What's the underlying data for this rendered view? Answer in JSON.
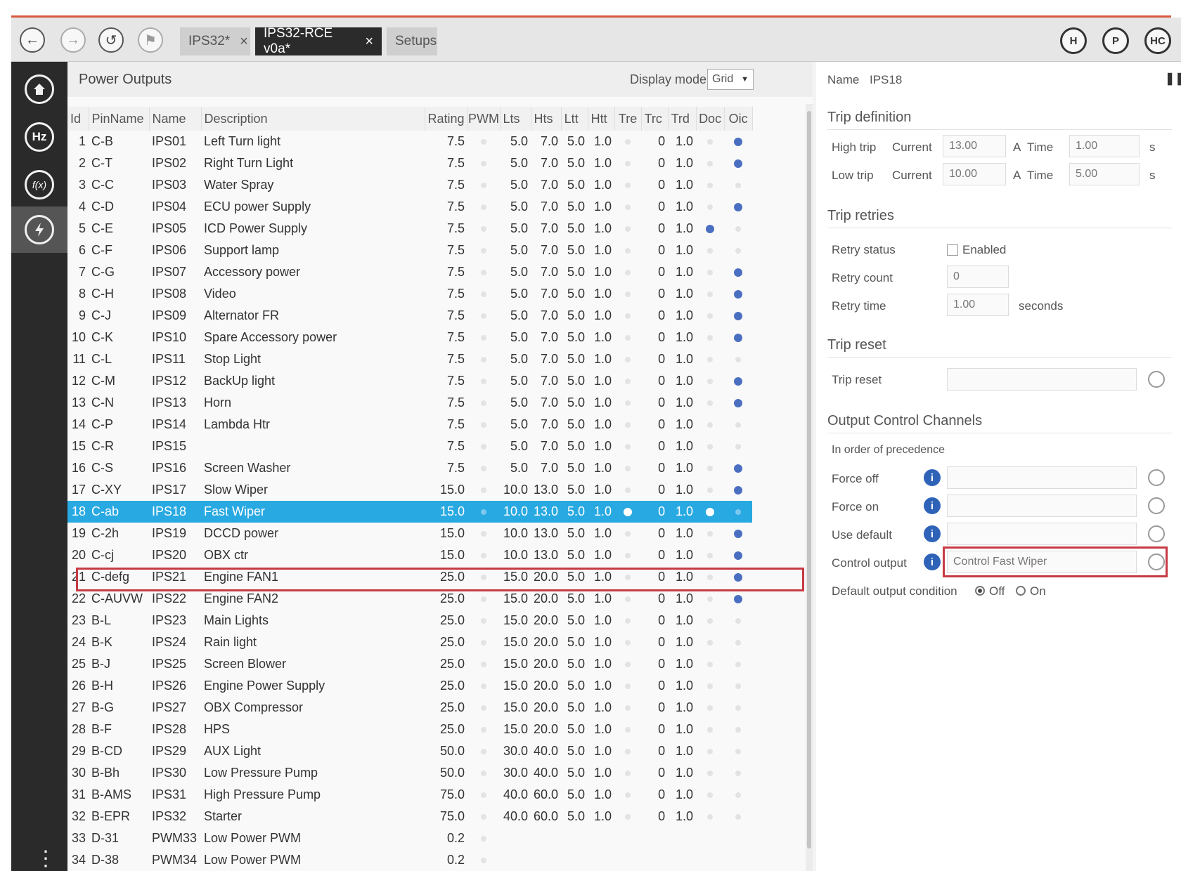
{
  "toolbar": {
    "tabs": [
      {
        "label": "IPS32*",
        "close": "×"
      },
      {
        "label": "IPS32-RCE v0a*",
        "close": "×"
      },
      {
        "label": "Setups"
      }
    ],
    "right_buttons": [
      "H",
      "P",
      "HC"
    ]
  },
  "sidebar": {
    "items": [
      "home",
      "Hz",
      "f(x)",
      "power"
    ]
  },
  "outputs": {
    "title": "Power Outputs",
    "display_mode_label": "Display mode",
    "display_mode_value": "Grid",
    "columns": [
      "Id",
      "PinName",
      "Name",
      "Description",
      "Rating",
      "PWM",
      "Lts",
      "Hts",
      "Ltt",
      "Htt",
      "Tre",
      "Trc",
      "Trd",
      "Doc",
      "Oic"
    ],
    "rows": [
      {
        "id": "1",
        "pin": "C-B",
        "name": "IPS01",
        "desc": "Left Turn light",
        "rating": "7.5",
        "pwm": false,
        "lts": "5.0",
        "hts": "7.0",
        "ltt": "5.0",
        "htt": "1.0",
        "tre": false,
        "trc": "0",
        "trd": "1.0",
        "doc": false,
        "oic": true
      },
      {
        "id": "2",
        "pin": "C-T",
        "name": "IPS02",
        "desc": "Right Turn Light",
        "rating": "7.5",
        "pwm": false,
        "lts": "5.0",
        "hts": "7.0",
        "ltt": "5.0",
        "htt": "1.0",
        "tre": false,
        "trc": "0",
        "trd": "1.0",
        "doc": false,
        "oic": true
      },
      {
        "id": "3",
        "pin": "C-C",
        "name": "IPS03",
        "desc": "Water Spray",
        "rating": "7.5",
        "pwm": false,
        "lts": "5.0",
        "hts": "7.0",
        "ltt": "5.0",
        "htt": "1.0",
        "tre": false,
        "trc": "0",
        "trd": "1.0",
        "doc": false,
        "oic": false
      },
      {
        "id": "4",
        "pin": "C-D",
        "name": "IPS04",
        "desc": "ECU power Supply",
        "rating": "7.5",
        "pwm": false,
        "lts": "5.0",
        "hts": "7.0",
        "ltt": "5.0",
        "htt": "1.0",
        "tre": false,
        "trc": "0",
        "trd": "1.0",
        "doc": false,
        "oic": true
      },
      {
        "id": "5",
        "pin": "C-E",
        "name": "IPS05",
        "desc": "ICD Power Supply",
        "rating": "7.5",
        "pwm": false,
        "lts": "5.0",
        "hts": "7.0",
        "ltt": "5.0",
        "htt": "1.0",
        "tre": false,
        "trc": "0",
        "trd": "1.0",
        "doc": true,
        "oic": false
      },
      {
        "id": "6",
        "pin": "C-F",
        "name": "IPS06",
        "desc": "Support lamp",
        "rating": "7.5",
        "pwm": false,
        "lts": "5.0",
        "hts": "7.0",
        "ltt": "5.0",
        "htt": "1.0",
        "tre": false,
        "trc": "0",
        "trd": "1.0",
        "doc": false,
        "oic": false
      },
      {
        "id": "7",
        "pin": "C-G",
        "name": "IPS07",
        "desc": "Accessory power",
        "rating": "7.5",
        "pwm": false,
        "lts": "5.0",
        "hts": "7.0",
        "ltt": "5.0",
        "htt": "1.0",
        "tre": false,
        "trc": "0",
        "trd": "1.0",
        "doc": false,
        "oic": true
      },
      {
        "id": "8",
        "pin": "C-H",
        "name": "IPS08",
        "desc": "Video",
        "rating": "7.5",
        "pwm": false,
        "lts": "5.0",
        "hts": "7.0",
        "ltt": "5.0",
        "htt": "1.0",
        "tre": false,
        "trc": "0",
        "trd": "1.0",
        "doc": false,
        "oic": true
      },
      {
        "id": "9",
        "pin": "C-J",
        "name": "IPS09",
        "desc": "Alternator FR",
        "rating": "7.5",
        "pwm": false,
        "lts": "5.0",
        "hts": "7.0",
        "ltt": "5.0",
        "htt": "1.0",
        "tre": false,
        "trc": "0",
        "trd": "1.0",
        "doc": false,
        "oic": true
      },
      {
        "id": "10",
        "pin": "C-K",
        "name": "IPS10",
        "desc": "Spare Accessory power",
        "rating": "7.5",
        "pwm": false,
        "lts": "5.0",
        "hts": "7.0",
        "ltt": "5.0",
        "htt": "1.0",
        "tre": false,
        "trc": "0",
        "trd": "1.0",
        "doc": false,
        "oic": true
      },
      {
        "id": "11",
        "pin": "C-L",
        "name": "IPS11",
        "desc": "Stop Light",
        "rating": "7.5",
        "pwm": false,
        "lts": "5.0",
        "hts": "7.0",
        "ltt": "5.0",
        "htt": "1.0",
        "tre": false,
        "trc": "0",
        "trd": "1.0",
        "doc": false,
        "oic": false
      },
      {
        "id": "12",
        "pin": "C-M",
        "name": "IPS12",
        "desc": "BackUp light",
        "rating": "7.5",
        "pwm": false,
        "lts": "5.0",
        "hts": "7.0",
        "ltt": "5.0",
        "htt": "1.0",
        "tre": false,
        "trc": "0",
        "trd": "1.0",
        "doc": false,
        "oic": true
      },
      {
        "id": "13",
        "pin": "C-N",
        "name": "IPS13",
        "desc": "Horn",
        "rating": "7.5",
        "pwm": false,
        "lts": "5.0",
        "hts": "7.0",
        "ltt": "5.0",
        "htt": "1.0",
        "tre": false,
        "trc": "0",
        "trd": "1.0",
        "doc": false,
        "oic": true
      },
      {
        "id": "14",
        "pin": "C-P",
        "name": "IPS14",
        "desc": "Lambda Htr",
        "rating": "7.5",
        "pwm": false,
        "lts": "5.0",
        "hts": "7.0",
        "ltt": "5.0",
        "htt": "1.0",
        "tre": false,
        "trc": "0",
        "trd": "1.0",
        "doc": false,
        "oic": false
      },
      {
        "id": "15",
        "pin": "C-R",
        "name": "IPS15",
        "desc": "",
        "rating": "7.5",
        "pwm": false,
        "lts": "5.0",
        "hts": "7.0",
        "ltt": "5.0",
        "htt": "1.0",
        "tre": false,
        "trc": "0",
        "trd": "1.0",
        "doc": false,
        "oic": false
      },
      {
        "id": "16",
        "pin": "C-S",
        "name": "IPS16",
        "desc": "Screen Washer",
        "rating": "7.5",
        "pwm": false,
        "lts": "5.0",
        "hts": "7.0",
        "ltt": "5.0",
        "htt": "1.0",
        "tre": false,
        "trc": "0",
        "trd": "1.0",
        "doc": false,
        "oic": true
      },
      {
        "id": "17",
        "pin": "C-XY",
        "name": "IPS17",
        "desc": "Slow Wiper",
        "rating": "15.0",
        "pwm": false,
        "lts": "10.0",
        "hts": "13.0",
        "ltt": "5.0",
        "htt": "1.0",
        "tre": false,
        "trc": "0",
        "trd": "1.0",
        "doc": false,
        "oic": true
      },
      {
        "id": "18",
        "pin": "C-ab",
        "name": "IPS18",
        "desc": "Fast Wiper",
        "rating": "15.0",
        "pwm": false,
        "lts": "10.0",
        "hts": "13.0",
        "ltt": "5.0",
        "htt": "1.0",
        "tre": true,
        "trc": "0",
        "trd": "1.0",
        "doc": true,
        "oic": false
      },
      {
        "id": "19",
        "pin": "C-2h",
        "name": "IPS19",
        "desc": "DCCD power",
        "rating": "15.0",
        "pwm": false,
        "lts": "10.0",
        "hts": "13.0",
        "ltt": "5.0",
        "htt": "1.0",
        "tre": false,
        "trc": "0",
        "trd": "1.0",
        "doc": false,
        "oic": true
      },
      {
        "id": "20",
        "pin": "C-cj",
        "name": "IPS20",
        "desc": "OBX ctr",
        "rating": "15.0",
        "pwm": false,
        "lts": "10.0",
        "hts": "13.0",
        "ltt": "5.0",
        "htt": "1.0",
        "tre": false,
        "trc": "0",
        "trd": "1.0",
        "doc": false,
        "oic": true
      },
      {
        "id": "21",
        "pin": "C-defg",
        "name": "IPS21",
        "desc": "Engine FAN1",
        "rating": "25.0",
        "pwm": false,
        "lts": "15.0",
        "hts": "20.0",
        "ltt": "5.0",
        "htt": "1.0",
        "tre": false,
        "trc": "0",
        "trd": "1.0",
        "doc": false,
        "oic": true
      },
      {
        "id": "22",
        "pin": "C-AUVW",
        "name": "IPS22",
        "desc": "Engine FAN2",
        "rating": "25.0",
        "pwm": false,
        "lts": "15.0",
        "hts": "20.0",
        "ltt": "5.0",
        "htt": "1.0",
        "tre": false,
        "trc": "0",
        "trd": "1.0",
        "doc": false,
        "oic": true
      },
      {
        "id": "23",
        "pin": "B-L",
        "name": "IPS23",
        "desc": "Main Lights",
        "rating": "25.0",
        "pwm": false,
        "lts": "15.0",
        "hts": "20.0",
        "ltt": "5.0",
        "htt": "1.0",
        "tre": false,
        "trc": "0",
        "trd": "1.0",
        "doc": false,
        "oic": false
      },
      {
        "id": "24",
        "pin": "B-K",
        "name": "IPS24",
        "desc": "Rain light",
        "rating": "25.0",
        "pwm": false,
        "lts": "15.0",
        "hts": "20.0",
        "ltt": "5.0",
        "htt": "1.0",
        "tre": false,
        "trc": "0",
        "trd": "1.0",
        "doc": false,
        "oic": false
      },
      {
        "id": "25",
        "pin": "B-J",
        "name": "IPS25",
        "desc": "Screen Blower",
        "rating": "25.0",
        "pwm": false,
        "lts": "15.0",
        "hts": "20.0",
        "ltt": "5.0",
        "htt": "1.0",
        "tre": false,
        "trc": "0",
        "trd": "1.0",
        "doc": false,
        "oic": false
      },
      {
        "id": "26",
        "pin": "B-H",
        "name": "IPS26",
        "desc": "Engine Power Supply",
        "rating": "25.0",
        "pwm": false,
        "lts": "15.0",
        "hts": "20.0",
        "ltt": "5.0",
        "htt": "1.0",
        "tre": false,
        "trc": "0",
        "trd": "1.0",
        "doc": false,
        "oic": false
      },
      {
        "id": "27",
        "pin": "B-G",
        "name": "IPS27",
        "desc": "OBX Compressor",
        "rating": "25.0",
        "pwm": false,
        "lts": "15.0",
        "hts": "20.0",
        "ltt": "5.0",
        "htt": "1.0",
        "tre": false,
        "trc": "0",
        "trd": "1.0",
        "doc": false,
        "oic": false
      },
      {
        "id": "28",
        "pin": "B-F",
        "name": "IPS28",
        "desc": "HPS",
        "rating": "25.0",
        "pwm": false,
        "lts": "15.0",
        "hts": "20.0",
        "ltt": "5.0",
        "htt": "1.0",
        "tre": false,
        "trc": "0",
        "trd": "1.0",
        "doc": false,
        "oic": false
      },
      {
        "id": "29",
        "pin": "B-CD",
        "name": "IPS29",
        "desc": "AUX Light",
        "rating": "50.0",
        "pwm": false,
        "lts": "30.0",
        "hts": "40.0",
        "ltt": "5.0",
        "htt": "1.0",
        "tre": false,
        "trc": "0",
        "trd": "1.0",
        "doc": false,
        "oic": false
      },
      {
        "id": "30",
        "pin": "B-Bh",
        "name": "IPS30",
        "desc": "Low Pressure Pump",
        "rating": "50.0",
        "pwm": false,
        "lts": "30.0",
        "hts": "40.0",
        "ltt": "5.0",
        "htt": "1.0",
        "tre": false,
        "trc": "0",
        "trd": "1.0",
        "doc": false,
        "oic": false
      },
      {
        "id": "31",
        "pin": "B-AMS",
        "name": "IPS31",
        "desc": "High Pressure Pump",
        "rating": "75.0",
        "pwm": false,
        "lts": "40.0",
        "hts": "60.0",
        "ltt": "5.0",
        "htt": "1.0",
        "tre": false,
        "trc": "0",
        "trd": "1.0",
        "doc": false,
        "oic": false
      },
      {
        "id": "32",
        "pin": "B-EPR",
        "name": "IPS32",
        "desc": "Starter",
        "rating": "75.0",
        "pwm": false,
        "lts": "40.0",
        "hts": "60.0",
        "ltt": "5.0",
        "htt": "1.0",
        "tre": false,
        "trc": "0",
        "trd": "1.0",
        "doc": false,
        "oic": false
      },
      {
        "id": "33",
        "pin": "D-31",
        "name": "PWM33",
        "desc": "Low Power PWM",
        "rating": "0.2",
        "pwm": false,
        "lts": "",
        "hts": "",
        "ltt": "",
        "htt": "",
        "tre": null,
        "trc": "",
        "trd": "",
        "doc": null,
        "oic": null
      },
      {
        "id": "34",
        "pin": "D-38",
        "name": "PWM34",
        "desc": "Low Power PWM",
        "rating": "0.2",
        "pwm": false,
        "lts": "",
        "hts": "",
        "ltt": "",
        "htt": "",
        "tre": null,
        "trc": "",
        "trd": "",
        "doc": null,
        "oic": null
      }
    ]
  },
  "details": {
    "name_label": "Name",
    "name_value": "IPS18",
    "trip_definition": {
      "title": "Trip definition",
      "high_label": "High trip",
      "low_label": "Low trip",
      "current_label": "Current",
      "time_label": "Time",
      "amp_unit": "A",
      "sec_unit": "s",
      "high_current": "13.00",
      "high_time": "1.00",
      "low_current": "10.00",
      "low_time": "5.00"
    },
    "trip_retries": {
      "title": "Trip retries",
      "status_label": "Retry status",
      "enabled_label": "Enabled",
      "count_label": "Retry count",
      "count_value": "0",
      "time_label": "Retry time",
      "time_value": "1.00",
      "time_unit": "seconds"
    },
    "trip_reset": {
      "title": "Trip reset",
      "label": "Trip reset",
      "value": ""
    },
    "occ": {
      "title": "Output Control Channels",
      "subtitle": "In order of precedence",
      "force_off_label": "Force off",
      "force_on_label": "Force on",
      "use_default_label": "Use default",
      "control_output_label": "Control output",
      "force_off_value": "",
      "force_on_value": "",
      "use_default_value": "",
      "control_output_value": "Control Fast Wiper",
      "default_condition_label": "Default output condition",
      "off_label": "Off",
      "on_label": "On",
      "default_selected": "Off"
    }
  },
  "colors": {
    "accent": "#29a9e1",
    "highlight": "#c73a43",
    "sidebar": "#2a2a2a",
    "dot": "#4a6fc1"
  }
}
